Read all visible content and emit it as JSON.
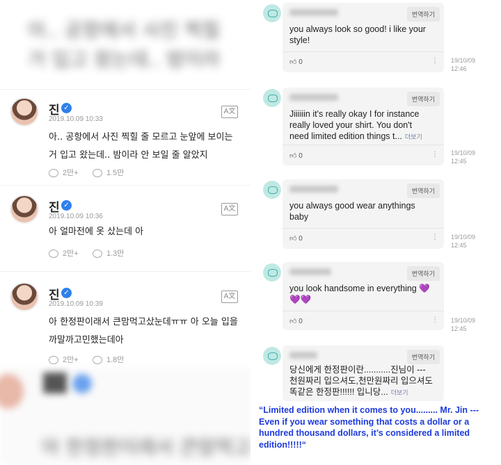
{
  "left": {
    "blurred_top_line1": "아.. 공항에서 사진 찍힐",
    "blurred_top_line2": "거 입고 왔는데.. 밤이라",
    "posts": [
      {
        "name": "진",
        "date": "2019.10.09 10:33",
        "text": "아.. 공항에서 사진 찍힐 줄 모르고 눈앞에 보이는 거 입고 왔는데.. 밤이라 안 보일 줄 알았지",
        "likes": "2만+",
        "comments": "1.5만"
      },
      {
        "name": "진",
        "date": "2019.10.09 10:36",
        "text": "아 얼마전에 옷 샀는데 아",
        "likes": "2만+",
        "comments": "1.3만"
      },
      {
        "name": "진",
        "date": "2019.10.09 10:39",
        "text": "아 한정판이래서 큰맘먹고샀눈데ㅠㅠ 아 오늘 입을까말까고민했는데아",
        "likes": "2만+",
        "comments": "1.8만"
      }
    ],
    "blurred_bottom_line": "아 한정판이래서 큰맘먹고"
  },
  "right": {
    "translate_label": "번역하기",
    "more_label": "더보기",
    "comments": [
      {
        "text": "you always look so good! i like your style!",
        "likes": "0",
        "time_date": "19/10/09",
        "time_clock": "12:46",
        "more": false
      },
      {
        "text": "Jiiiiiin it's really okay I for instance really loved your shirt. You don't need limited edition things t...",
        "likes": "0",
        "time_date": "19/10/09",
        "time_clock": "12:45",
        "more": true
      },
      {
        "text": "you always good wear anythings baby",
        "likes": "0",
        "time_date": "19/10/09",
        "time_clock": "12:45",
        "more": false
      },
      {
        "text": "you look handsome in everything 💜💜💜",
        "likes": "0",
        "time_date": "19/10/09",
        "time_clock": "12:45",
        "more": false
      },
      {
        "text": "당신에게 한정판이란...........진님이 --- 천원짜리 입으셔도,천만원짜리 입으셔도 똑같은 한정판!!!!!!   입니당...",
        "likes": "",
        "time_date": "",
        "time_clock": "",
        "more": true
      }
    ],
    "caption": "“Limited edition when it comes to you......... Mr. Jin --- Even if you wear something that costs a dollar or a hundred thousand dollars, it’s considered a limited edition!!!!!“"
  },
  "colors": {
    "verified": "#2f80ed",
    "caption": "#1d3bdb",
    "bubble": "#f4f4f4"
  }
}
